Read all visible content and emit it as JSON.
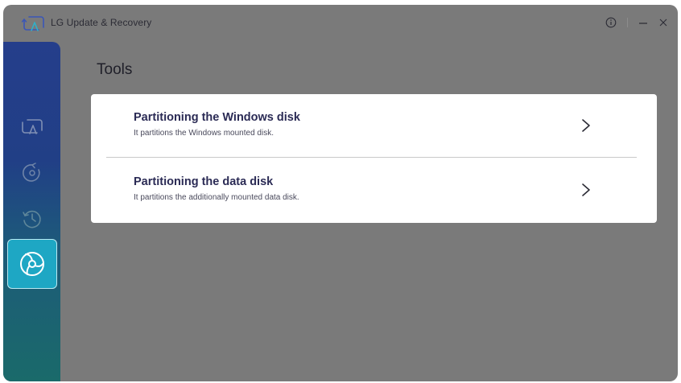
{
  "app": {
    "title": "LG Update & Recovery"
  },
  "titlebar": {
    "info_icon": "info-icon",
    "minimize_icon": "minimize-icon",
    "close_icon": "close-icon"
  },
  "sidebar": {
    "items": [
      {
        "icon": "update-icon",
        "active": false
      },
      {
        "icon": "recovery-icon",
        "active": false
      },
      {
        "icon": "history-icon",
        "active": false
      },
      {
        "icon": "tools-icon",
        "active": true
      }
    ]
  },
  "page": {
    "title": "Tools"
  },
  "tools": {
    "items": [
      {
        "title": "Partitioning the Windows disk",
        "description": "It partitions the Windows mounted disk."
      },
      {
        "title": "Partitioning the data disk",
        "description": "It partitions the additionally mounted data disk."
      }
    ]
  },
  "colors": {
    "sidebar_top": "#253e8b",
    "sidebar_bottom": "#1a6a6a",
    "active_item": "#1ea7c4",
    "overlay": "#7a7a7a",
    "card": "#ffffff",
    "title_text": "#2b2b55"
  }
}
